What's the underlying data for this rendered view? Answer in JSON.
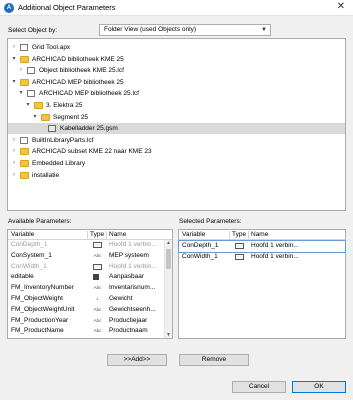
{
  "window": {
    "title": "Additional Object Parameters",
    "app_icon_label": "A"
  },
  "select_by": {
    "label": "Select Object by:",
    "value": "Folder View (used Objects only)"
  },
  "tree": [
    {
      "level": 0,
      "expanded": false,
      "kind": "file",
      "label": "Grid Tool.apx"
    },
    {
      "level": 0,
      "expanded": true,
      "kind": "folder",
      "label": "ARCHICAD bibliotheek KME 25"
    },
    {
      "level": 1,
      "expanded": false,
      "kind": "file",
      "label": "Object bibliotheek KME 25.lcf"
    },
    {
      "level": 0,
      "expanded": true,
      "kind": "folder",
      "label": "ARCHICAD MEP bibliotheek 25"
    },
    {
      "level": 1,
      "expanded": true,
      "kind": "file",
      "label": "ARCHICAD MEP bibliotheek 25.lcf"
    },
    {
      "level": 2,
      "expanded": true,
      "kind": "folder",
      "label": "3. Elektra 25"
    },
    {
      "level": 3,
      "expanded": true,
      "kind": "folder",
      "label": "Segment 25"
    },
    {
      "level": 4,
      "expanded": null,
      "kind": "gsm",
      "label": "Kabelladder 25.gsm",
      "selected": true
    },
    {
      "level": 0,
      "expanded": false,
      "kind": "file",
      "label": "BuiltInLibraryParts.lcf"
    },
    {
      "level": 0,
      "expanded": false,
      "kind": "folder",
      "label": "ARCHICAD subset KME 22 naar KME 23"
    },
    {
      "level": 0,
      "expanded": false,
      "kind": "folder",
      "label": "Embedded Library"
    },
    {
      "level": 0,
      "expanded": false,
      "kind": "folder",
      "label": "installatie"
    }
  ],
  "available": {
    "label": "Available Parameters:",
    "columns": [
      "Variable",
      "Type",
      "Name"
    ],
    "rows": [
      {
        "variable": "ConDepth_1",
        "type": "box",
        "name": "Hoofd 1 verbin...",
        "gray": true
      },
      {
        "variable": "ConSystem_1",
        "type": "abc",
        "name": "MEP systeem",
        "gray": false
      },
      {
        "variable": "ConWidth_1",
        "type": "box",
        "name": "Hoofd 1 verbin...",
        "gray": true
      },
      {
        "variable": "editable",
        "type": "chk",
        "name": "Aanpasbaar",
        "gray": false
      },
      {
        "variable": "FM_InventoryNumber",
        "type": "abc",
        "name": "Inventarisnum...",
        "gray": false
      },
      {
        "variable": "FM_ObjectWeight",
        "type": "wt",
        "name": "Gewicht",
        "gray": false
      },
      {
        "variable": "FM_ObjectWeightUnit",
        "type": "abc",
        "name": "Gewichtseenh...",
        "gray": false
      },
      {
        "variable": "FM_ProductionYear",
        "type": "abc",
        "name": "Productiejaar",
        "gray": false
      },
      {
        "variable": "FM_ProductName",
        "type": "abc",
        "name": "Productnaam",
        "gray": false
      }
    ]
  },
  "selected": {
    "label": "Selected Parameters:",
    "columns": [
      "Variable",
      "Type",
      "Name"
    ],
    "rows": [
      {
        "variable": "ConDepth_1",
        "type": "box",
        "name": "Hoofd 1 verbin..."
      },
      {
        "variable": "ConWidth_1",
        "type": "box",
        "name": "Hoofd 1 verbin..."
      }
    ]
  },
  "buttons": {
    "add": ">>Add>>",
    "remove": "Remove",
    "cancel": "Cancel",
    "ok": "OK"
  },
  "type_glyphs": {
    "abc": "Abc",
    "box": "⬚",
    "wt": "⊥",
    "chk": ""
  }
}
